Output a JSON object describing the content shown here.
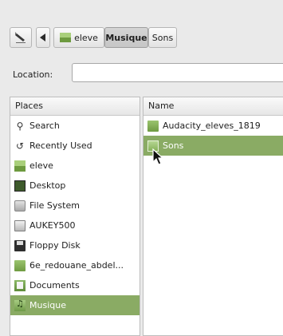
{
  "toolbar": {
    "edit_icon": "pencil-edit-icon",
    "back_icon": "left-arrow-icon",
    "breadcrumbs": [
      {
        "label": "eleve",
        "icon": "home-folder-icon"
      },
      {
        "label": "Musique"
      },
      {
        "label": "Sons"
      }
    ]
  },
  "location": {
    "label": "Location:",
    "value": ""
  },
  "places": {
    "header": "Places",
    "items": [
      {
        "label": "Search",
        "icon": "search-icon"
      },
      {
        "label": "Recently Used",
        "icon": "recent-icon"
      },
      {
        "label": "eleve",
        "icon": "home-folder-icon"
      },
      {
        "label": "Desktop",
        "icon": "desktop-icon"
      },
      {
        "label": "File System",
        "icon": "file-system-icon"
      },
      {
        "label": "AUKEY500",
        "icon": "drive-icon"
      },
      {
        "label": "Floppy Disk",
        "icon": "floppy-icon"
      },
      {
        "label": "6e_redouane_abdel...",
        "icon": "folder-icon"
      },
      {
        "label": "Documents",
        "icon": "documents-folder-icon"
      },
      {
        "label": "Musique",
        "icon": "music-folder-icon",
        "selected": true
      }
    ]
  },
  "files": {
    "header": "Name",
    "items": [
      {
        "label": "Audacity_eleves_1819",
        "icon": "folder-icon"
      },
      {
        "label": "Sons",
        "icon": "folder-icon",
        "selected": true
      }
    ]
  }
}
